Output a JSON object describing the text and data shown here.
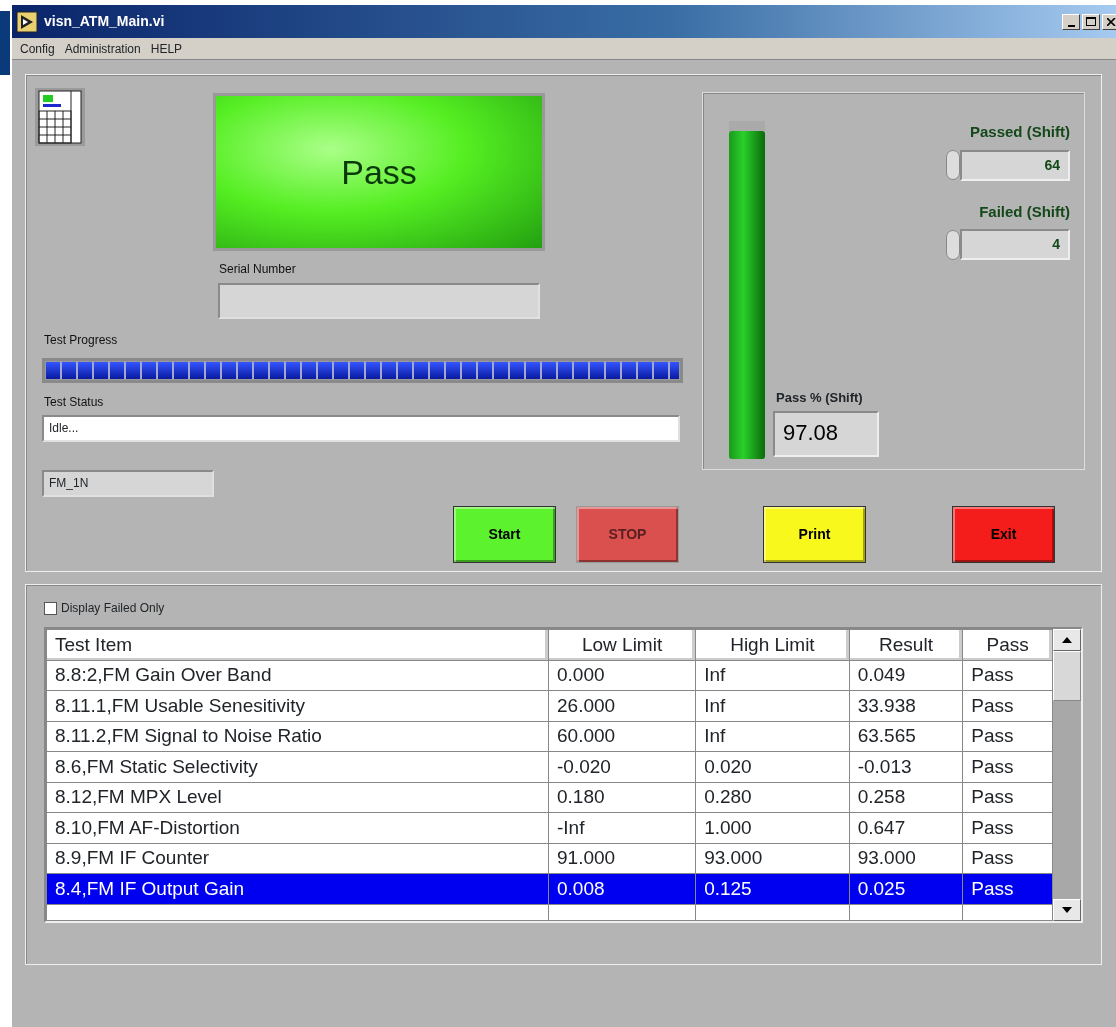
{
  "window": {
    "title": "visn_ATM_Main.vi"
  },
  "menu": [
    "Config",
    "Administration",
    "HELP"
  ],
  "indicator": {
    "text": "Pass"
  },
  "serial_number": {
    "label": "Serial Number"
  },
  "test_progress": {
    "label": "Test Progress",
    "level": 1.0
  },
  "test_status": {
    "label": "Test Status",
    "value": "Idle..."
  },
  "mode": {
    "value": "FM_1N"
  },
  "buttons": [
    {
      "label": "Start",
      "color": "#5cf22e",
      "disabled": false
    },
    {
      "label": "STOP",
      "color": "#d9504f",
      "disabled": true
    },
    {
      "label": "Print",
      "color": "#f8f81c",
      "disabled": false
    },
    {
      "label": "Exit",
      "color": "#f51c1c",
      "disabled": false
    }
  ],
  "shift": {
    "pass_meter": {
      "level": 0.97
    },
    "pass_percent_label": "Pass % (Shift)",
    "pass_percent": "97.08",
    "counters": [
      {
        "label": "Passed (Shift)",
        "value": "64"
      },
      {
        "label": "Failed (Shift)",
        "value": "4"
      }
    ]
  },
  "display_failed_only": {
    "label": "Display Failed Only",
    "checked": false
  },
  "table": {
    "columns": [
      "Test Item",
      "Low Limit",
      "High Limit",
      "Result",
      "Pass"
    ],
    "rows": [
      {
        "cells": [
          "8.8:2,FM Gain Over Band",
          "0.000",
          "Inf",
          "0.049",
          "Pass"
        ],
        "selected": false
      },
      {
        "cells": [
          "8.11.1,FM Usable Senesitivity",
          "26.000",
          "Inf",
          "33.938",
          "Pass"
        ],
        "selected": false
      },
      {
        "cells": [
          "8.11.2,FM Signal to Noise Ratio",
          "60.000",
          "Inf",
          "63.565",
          "Pass"
        ],
        "selected": false
      },
      {
        "cells": [
          "8.6,FM Static Selectivity",
          "-0.020",
          "0.020",
          "-0.013",
          "Pass"
        ],
        "selected": false
      },
      {
        "cells": [
          "8.12,FM MPX Level",
          "0.180",
          "0.280",
          "0.258",
          "Pass"
        ],
        "selected": false
      },
      {
        "cells": [
          "8.10,FM AF-Distortion",
          "-Inf",
          "1.000",
          "0.647",
          "Pass"
        ],
        "selected": false
      },
      {
        "cells": [
          "8.9,FM IF Counter",
          "91.000",
          "93.000",
          "93.000",
          "Pass"
        ],
        "selected": false
      },
      {
        "cells": [
          "8.4,FM IF Output Gain",
          "0.008",
          "0.125",
          "0.025",
          "Pass"
        ],
        "selected": true
      }
    ]
  }
}
